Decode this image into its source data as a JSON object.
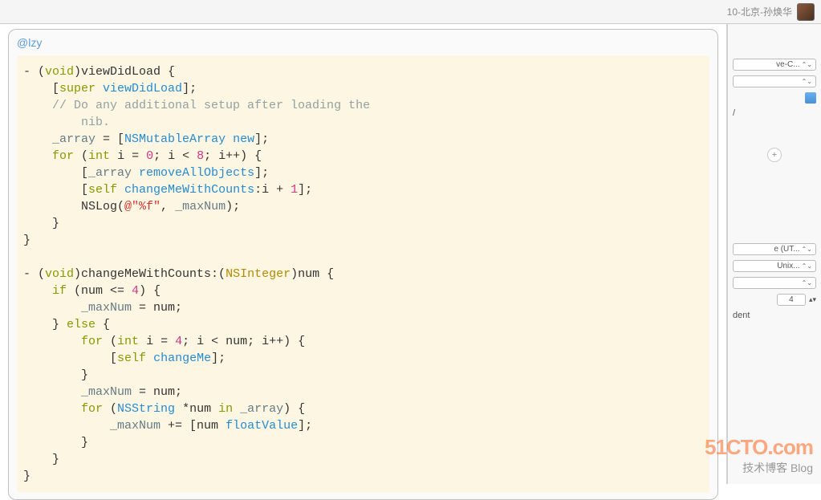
{
  "header": {
    "user_label": "10-北京-孙焕华"
  },
  "bubble": {
    "mention": "@lzy"
  },
  "code": {
    "l1a": "- (",
    "l1b": "void",
    "l1c": ")viewDidLoad {",
    "l2a": "    [",
    "l2b": "super",
    "l2c": " ",
    "l2d": "viewDidLoad",
    "l2e": "];",
    "l3": "    // Do any additional setup after loading the\n        nib.",
    "l4a": "    ",
    "l4b": "_array",
    "l4c": " = [",
    "l4d": "NSMutableArray",
    "l4e": " ",
    "l4f": "new",
    "l4g": "];",
    "l5a": "    ",
    "l5b": "for",
    "l5c": " (",
    "l5d": "int",
    "l5e": " i = ",
    "l5f": "0",
    "l5g": "; i < ",
    "l5h": "8",
    "l5i": "; i++) {",
    "l6a": "        [",
    "l6b": "_array",
    "l6c": " ",
    "l6d": "removeAllObjects",
    "l6e": "];",
    "l7a": "        [",
    "l7b": "self",
    "l7c": " ",
    "l7d": "changeMeWithCounts",
    "l7e": ":i + ",
    "l7f": "1",
    "l7g": "];",
    "l8a": "        NSLog(",
    "l8b": "@\"%f\"",
    "l8c": ", ",
    "l8d": "_maxNum",
    "l8e": ");",
    "l9": "    }",
    "l10": "}",
    "l12a": "- (",
    "l12b": "void",
    "l12c": ")changeMeWithCounts:(",
    "l12d": "NSInteger",
    "l12e": ")num {",
    "l13a": "    ",
    "l13b": "if",
    "l13c": " (num <= ",
    "l13d": "4",
    "l13e": ") {",
    "l14a": "        ",
    "l14b": "_maxNum",
    "l14c": " = num;",
    "l15a": "    } ",
    "l15b": "else",
    "l15c": " {",
    "l16a": "        ",
    "l16b": "for",
    "l16c": " (",
    "l16d": "int",
    "l16e": " i = ",
    "l16f": "4",
    "l16g": "; i < num; i++) {",
    "l17a": "            [",
    "l17b": "self",
    "l17c": " ",
    "l17d": "changeMe",
    "l17e": "];",
    "l18": "        }",
    "l19a": "        ",
    "l19b": "_maxNum",
    "l19c": " = num;",
    "l20a": "        ",
    "l20b": "for",
    "l20c": " (",
    "l20d": "NSString",
    "l20e": " *num ",
    "l20f": "in",
    "l20g": " ",
    "l20h": "_array",
    "l20i": ") {",
    "l21a": "            ",
    "l21b": "_maxNum",
    "l21c": " += [num ",
    "l21d": "floatValue",
    "l21e": "];",
    "l22": "        }",
    "l23": "    }",
    "l24": "}"
  },
  "side": {
    "sel1": "ve-C...",
    "path": "/",
    "enc": "e (UT...",
    "le": "Unix...",
    "indent_val": "4",
    "dent": "dent"
  },
  "wm": {
    "l1": "51CTO.com",
    "l2": "技术博客  Blog"
  }
}
